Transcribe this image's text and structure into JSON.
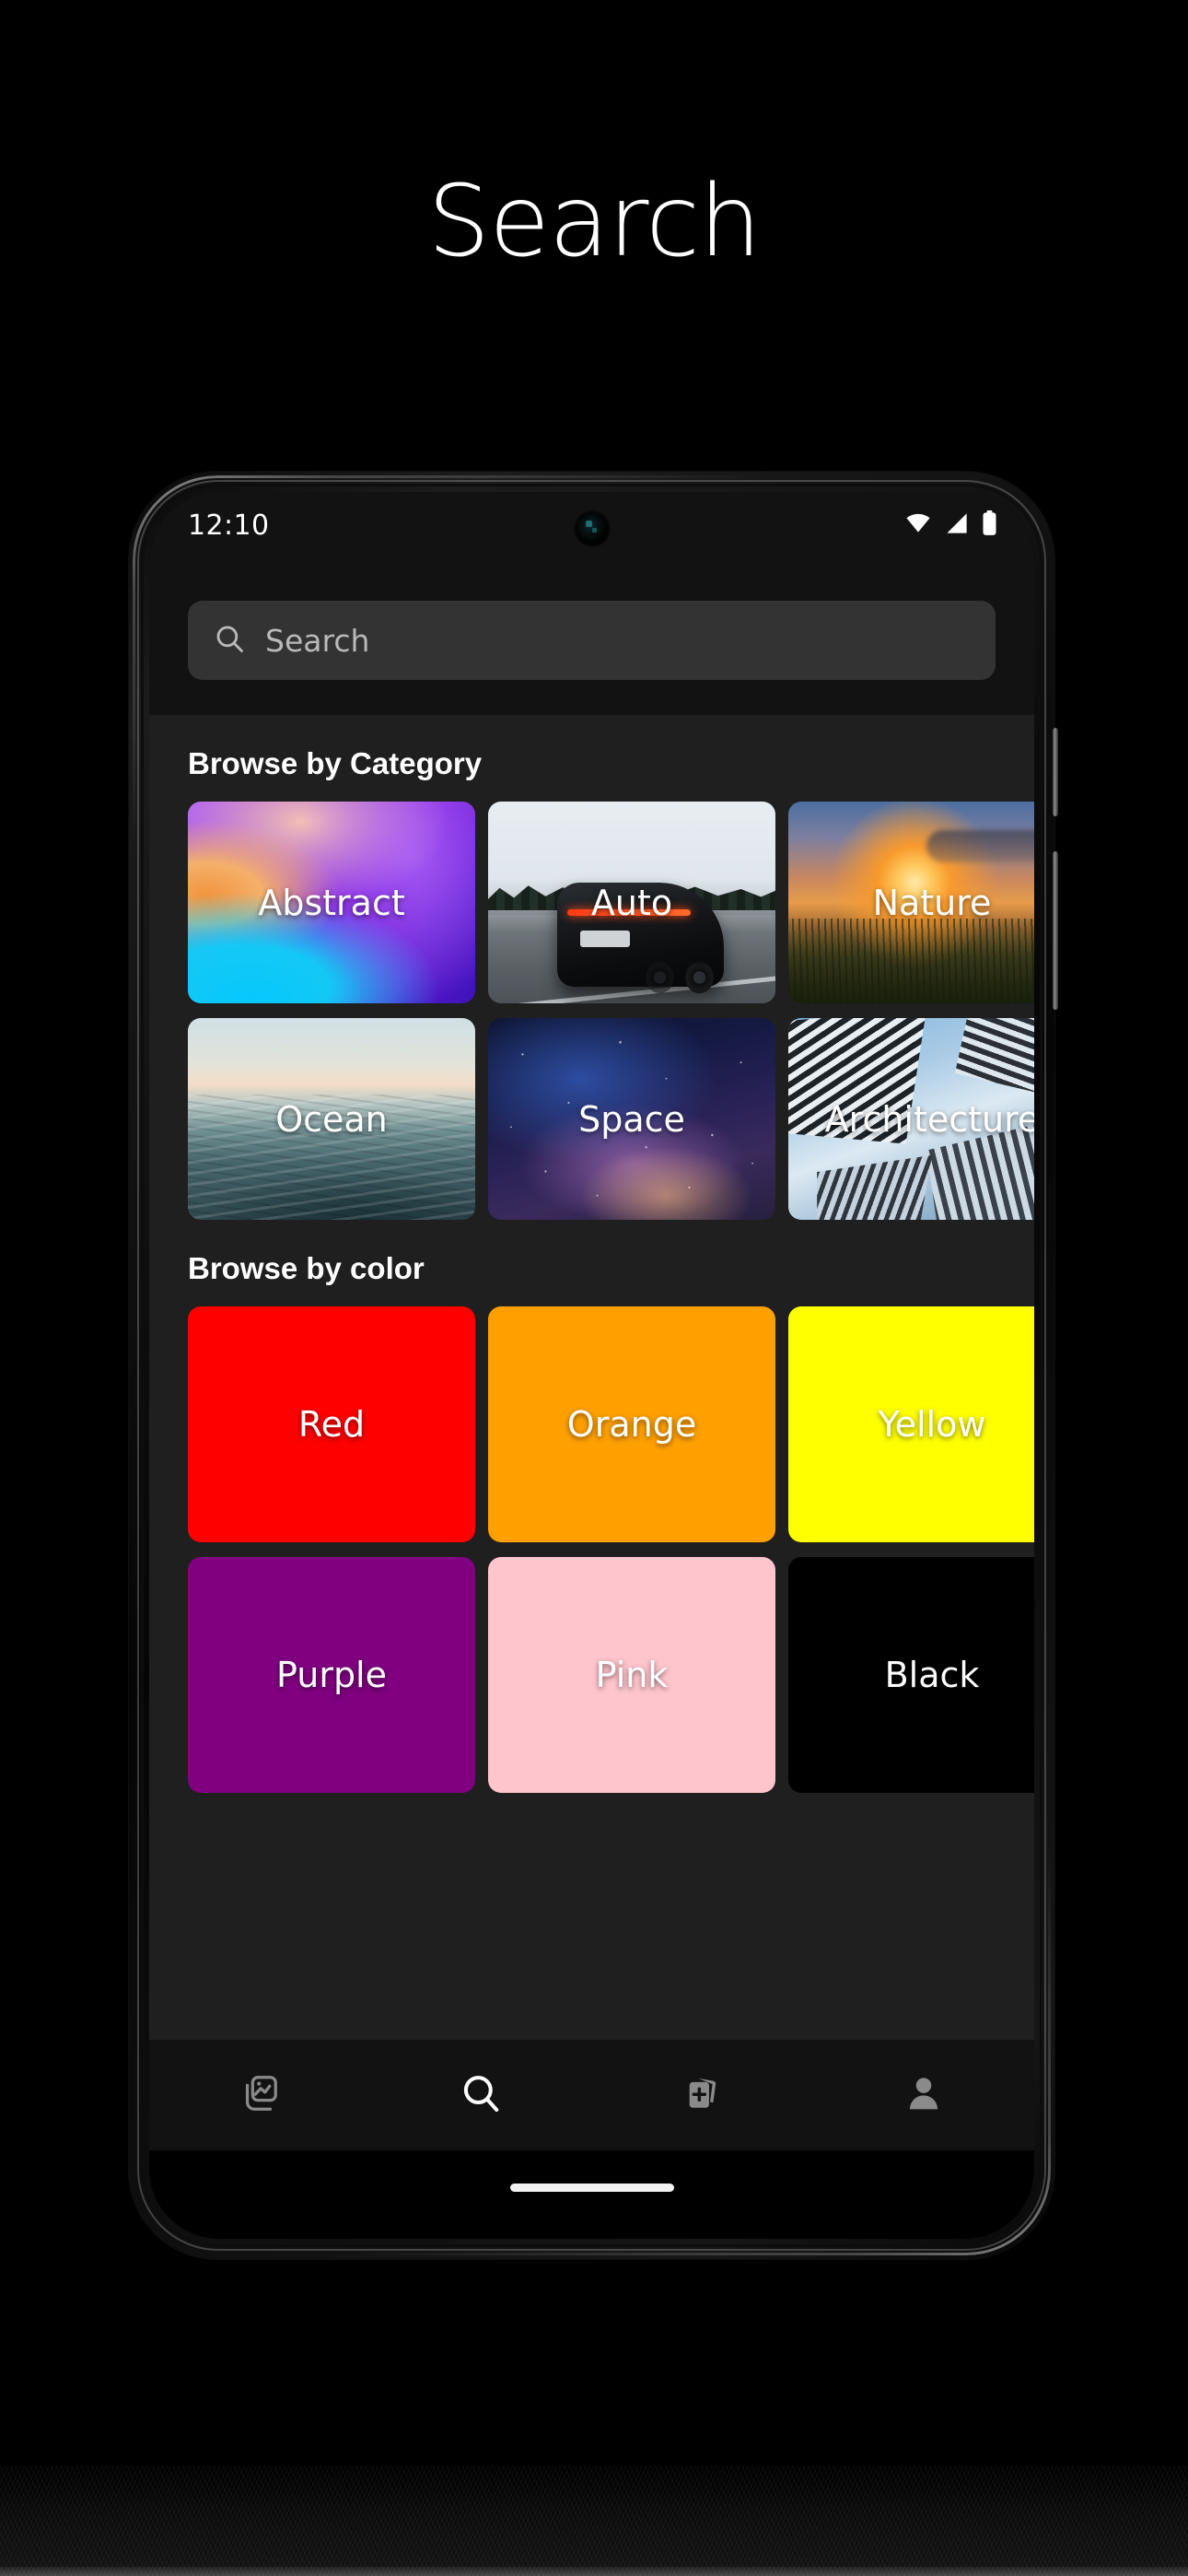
{
  "page": {
    "title": "Search",
    "background_color": "#000000"
  },
  "device": {
    "status_bar": {
      "time": "12:10",
      "icons": [
        "wifi-icon",
        "cellular-signal-icon",
        "battery-icon"
      ]
    },
    "camera": "front-camera-punch-hole",
    "gesture_bar": "home-gesture-indicator"
  },
  "search": {
    "icon": "search-icon",
    "placeholder": "Search",
    "value": ""
  },
  "sections": {
    "category": {
      "title": "Browse by Category",
      "tiles": [
        {
          "label": "Abstract",
          "art": "abstract-gradient-thumbnail"
        },
        {
          "label": "Auto",
          "art": "sports-car-photo-thumbnail"
        },
        {
          "label": "Nature",
          "art": "sunset-landscape-photo-thumbnail"
        },
        {
          "label": "Ocean",
          "art": "ocean-waves-photo-thumbnail"
        },
        {
          "label": "Space",
          "art": "galaxy-photo-thumbnail"
        },
        {
          "label": "Architecture",
          "art": "buildings-photo-thumbnail"
        }
      ]
    },
    "color": {
      "title": "Browse by color",
      "tiles": [
        {
          "label": "Red",
          "color": "#FF0000",
          "text_color": "#FFFFFF"
        },
        {
          "label": "Orange",
          "color": "#FFA000",
          "text_color": "#FFFFFF"
        },
        {
          "label": "Yellow",
          "color": "#FFFF00",
          "text_color": "#FFFFFF"
        },
        {
          "label": "Purple",
          "color": "#800080",
          "text_color": "#FFFFFF"
        },
        {
          "label": "Pink",
          "color": "#FFC5CC",
          "text_color": "#FFFFFF"
        },
        {
          "label": "Black",
          "color": "#000000",
          "text_color": "#FFFFFF"
        }
      ]
    }
  },
  "bottom_nav": {
    "items": [
      {
        "icon": "photos-gallery-icon",
        "active": false
      },
      {
        "icon": "search-icon",
        "active": true
      },
      {
        "icon": "add-collection-icon",
        "active": false
      },
      {
        "icon": "profile-person-icon",
        "active": false
      }
    ],
    "active_color": "#FFFFFF",
    "inactive_color": "#8A8A8A"
  }
}
